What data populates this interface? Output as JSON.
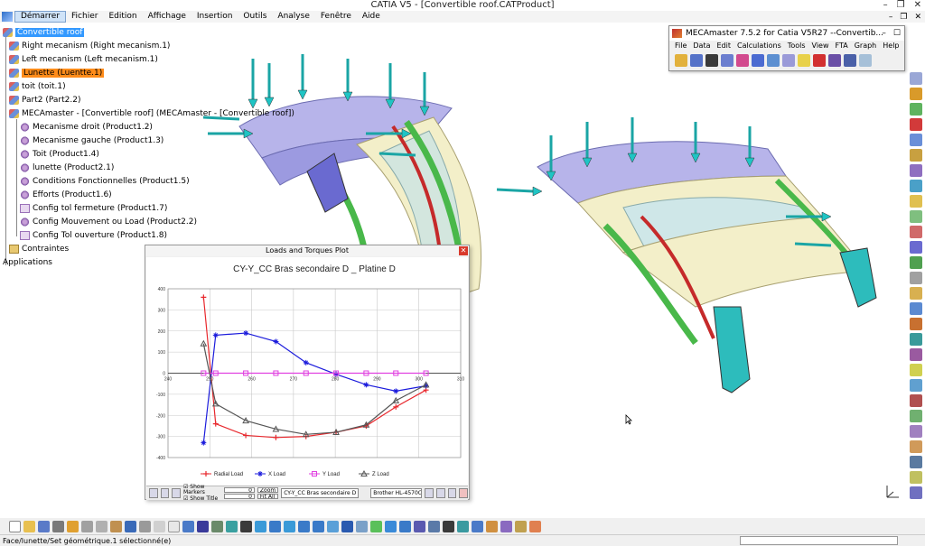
{
  "window": {
    "title": "CATIA V5 - [Convertible roof.CATProduct]"
  },
  "menu": [
    "Démarrer",
    "Fichier",
    "Edition",
    "Affichage",
    "Insertion",
    "Outils",
    "Analyse",
    "Fenêtre",
    "Aide"
  ],
  "tree": [
    {
      "label": "Convertible roof"
    },
    {
      "label": "Right mecanism (Right mecanism.1)"
    },
    {
      "label": "Left mecanism (Left mecanism.1)"
    },
    {
      "label": "Lunette (Luentte.1)"
    },
    {
      "label": "toit (toit.1)"
    },
    {
      "label": "Part2 (Part2.2)"
    },
    {
      "label": "MECAmaster - [Convertible roof] (MECAmaster - [Convertible roof])"
    },
    {
      "label": "Mecanisme droit (Product1.2)"
    },
    {
      "label": "Mecanisme gauche (Product1.3)"
    },
    {
      "label": "Toit (Product1.4)"
    },
    {
      "label": "lunette (Product2.1)"
    },
    {
      "label": "Conditions Fonctionnelles (Product1.5)"
    },
    {
      "label": "Efforts (Product1.6)"
    },
    {
      "label": "Config tol fermeture (Product1.7)"
    },
    {
      "label": "Config Mouvement ou Load (Product2.2)"
    },
    {
      "label": "Config Tol ouverture (Product1.8)"
    },
    {
      "label": "Contraintes"
    },
    {
      "label": "Applications"
    }
  ],
  "mecamaster": {
    "title": "MECAmaster 7.5.2 for Catia V5R27   --Convertib...",
    "menu": [
      "File",
      "Data",
      "Edit",
      "Calculations",
      "Tools",
      "View",
      "FTA",
      "Graph",
      "Help"
    ]
  },
  "plot_window": {
    "title": "Loads and Torques Plot",
    "show_markers_label": "Show Markers",
    "show_title_label": "Show Title",
    "markers_value": "0",
    "title_value": "0",
    "zoom_label": "Zoom",
    "fit_all_label": "Fit All",
    "selected_plot": "CY-Y_CC Bras secondaire D _ Platine D",
    "printer": "Brother HL-4570CDW se..."
  },
  "chart_data": {
    "type": "line",
    "title": "CY-Y_CC Bras secondaire D _ Platine D",
    "xlabel": "",
    "ylabel": "",
    "xlim": [
      240,
      310
    ],
    "ylim": [
      -400,
      400
    ],
    "xticks": [
      240,
      250,
      260,
      270,
      280,
      290,
      300,
      310
    ],
    "yticks": [
      -400,
      -300,
      -200,
      -100,
      0,
      100,
      200,
      300,
      400
    ],
    "grid": true,
    "legend": "bottom",
    "series": [
      {
        "name": "Radial Load",
        "color": "#e8282d",
        "marker": "plus",
        "x": [
          248.5,
          251.4,
          258.6,
          265.8,
          273.0,
          280.2,
          287.4,
          294.5,
          301.7
        ],
        "y": [
          360,
          -240,
          -295,
          -305,
          -300,
          -280,
          -250,
          -160,
          -80
        ]
      },
      {
        "name": "X Load",
        "color": "#1c1cdc",
        "marker": "star",
        "x": [
          248.5,
          251.4,
          258.6,
          265.8,
          273.0,
          280.2,
          287.4,
          294.5,
          301.7
        ],
        "y": [
          -330,
          180,
          190,
          150,
          50,
          -5,
          -55,
          -85,
          -60
        ]
      },
      {
        "name": "Y Load",
        "color": "#e040e0",
        "marker": "square",
        "x": [
          248.5,
          251.4,
          258.6,
          265.8,
          273.0,
          280.2,
          287.4,
          294.5,
          301.7
        ],
        "y": [
          0,
          0,
          0,
          0,
          0,
          0,
          0,
          0,
          0
        ]
      },
      {
        "name": "Z Load",
        "color": "#555555",
        "marker": "triangle",
        "x": [
          248.5,
          251.4,
          258.6,
          265.8,
          273.0,
          280.2,
          287.4,
          294.5,
          301.7
        ],
        "y": [
          140,
          -145,
          -225,
          -265,
          -290,
          -280,
          -245,
          -130,
          -55
        ]
      }
    ]
  },
  "status": {
    "message": "Face/lunette/Set géométrique.1 sélectionné(e)"
  }
}
